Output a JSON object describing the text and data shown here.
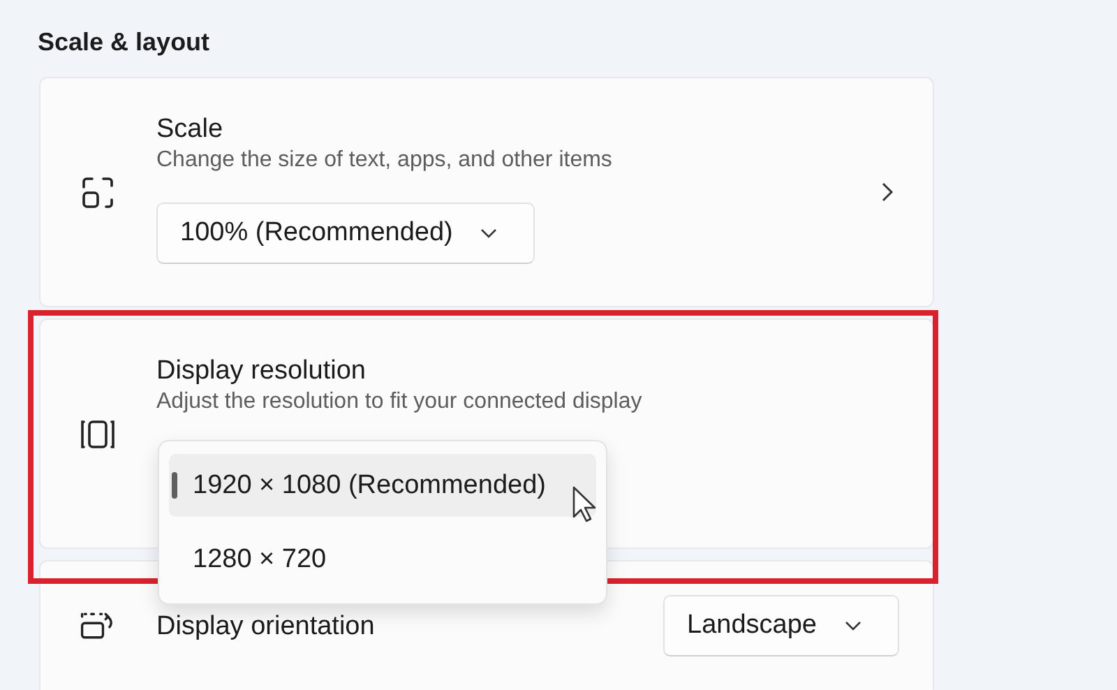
{
  "section_title": "Scale & layout",
  "settings": [
    {
      "kind": "link",
      "title": "Scale",
      "description": "Change the size of text, apps, and other items",
      "combo": "100% (Recommended)"
    },
    {
      "kind": "stacked",
      "title": "Display resolution",
      "description": "Adjust the resolution to fit your connected display"
    },
    {
      "kind": "inline",
      "title": "Display orientation",
      "combo": "Landscape"
    }
  ],
  "resolution_menu": {
    "options": [
      {
        "label": "1920 × 1080 (Recommended)",
        "selected": true
      },
      {
        "label": "1280 × 720",
        "selected": false
      }
    ]
  }
}
